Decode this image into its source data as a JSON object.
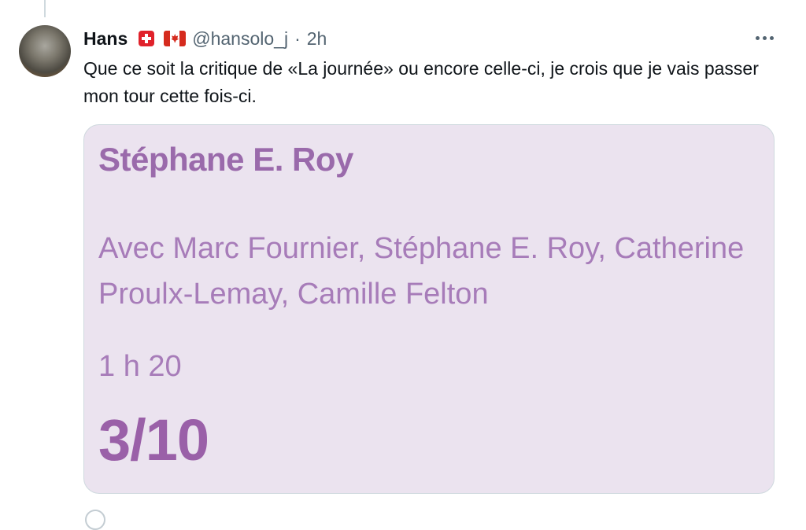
{
  "tweet": {
    "author_name": "Hans",
    "handle": "@hansolo_j",
    "separator": "·",
    "time": "2h",
    "text": "Que ce soit la critique de «La journée» ou encore celle-ci, je crois que je vais passer mon tour cette fois-ci."
  },
  "card": {
    "title": "Stéphane E. Roy",
    "cast": "Avec Marc Fournier, Stéphane E. Roy, Catherine Proulx-Lemay, Camille Felton",
    "duration": "1 h 20",
    "rating": "3/10",
    "colors": {
      "background": "#ebe3ef",
      "text": "#a77cb9"
    }
  },
  "icons": {
    "flags": [
      "swiss-flag",
      "canada-flag"
    ],
    "more": "more-icon"
  }
}
